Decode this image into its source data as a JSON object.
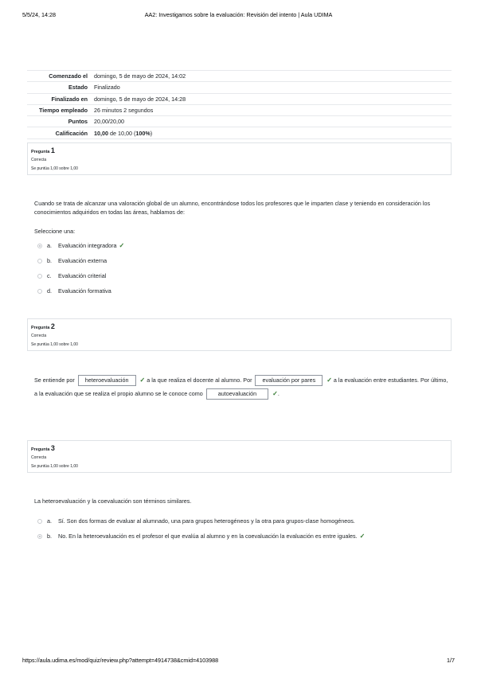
{
  "print": {
    "date": "5/5/24, 14:28",
    "title": "AA2: Investigamos sobre la evaluación: Revisión del intento | Aula UDIMA",
    "url": "https://aula.udima.es/mod/quiz/review.php?attempt=4914738&cmid=4103988",
    "page": "1/7"
  },
  "summary": [
    {
      "label": "Comenzado el",
      "value": "domingo, 5 de mayo de 2024, 14:02"
    },
    {
      "label": "Estado",
      "value": "Finalizado"
    },
    {
      "label": "Finalizado en",
      "value": "domingo, 5 de mayo de 2024, 14:28"
    },
    {
      "label": "Tiempo empleado",
      "value": "26 minutos 2 segundos"
    },
    {
      "label": "Puntos",
      "value": "20,00/20,00"
    },
    {
      "label": "Calificación",
      "grade": "10,00",
      "of": " de 10,00 (",
      "percent": "100%",
      "close": ")"
    }
  ],
  "questions": [
    {
      "prefix": "Pregunta ",
      "number": "1",
      "state": "Correcta",
      "mark": "Se puntúa 1,00 sobre 1,00",
      "text": "Cuando se trata de alcanzar una valoración global de un alumno, encontrándose todos los profesores que le imparten clase y teniendo en consideración los conocimientos adquiridos en todas las áreas, hablamos de:",
      "prompt": "Seleccione una:",
      "options": [
        {
          "letter": "a.",
          "text": "Evaluación integradora",
          "checked": true,
          "correct": true
        },
        {
          "letter": "b.",
          "text": "Evaluación externa",
          "checked": false,
          "correct": false
        },
        {
          "letter": "c.",
          "text": "Evaluación criterial",
          "checked": false,
          "correct": false
        },
        {
          "letter": "d.",
          "text": "Evaluación formativa",
          "checked": false,
          "correct": false
        }
      ]
    },
    {
      "prefix": "Pregunta ",
      "number": "2",
      "state": "Correcta",
      "mark": "Se puntúa 1,00 sobre 1,00",
      "parts": {
        "t1": "Se entiende por",
        "b1": "heteroevaluación",
        "t2": "a la que realiza el docente al alumno. Por",
        "b2": "evaluación por pares",
        "t3": "a la evaluación entre estudiantes. Por último, a la evaluación que se realiza el propio alumno se le conoce como",
        "b3": "autoevaluación",
        "t4": "."
      }
    },
    {
      "prefix": "Pregunta ",
      "number": "3",
      "state": "Correcta",
      "mark": "Se puntúa 1,00 sobre 1,00",
      "text": "La heteroevaluación y la coevaluación son términos similares.",
      "options": [
        {
          "letter": "a.",
          "text": "Sí. Son dos formas de evaluar al alumnado, una para grupos heterogéneos y la otra para grupos-clase homogéneos.",
          "checked": false,
          "correct": false
        },
        {
          "letter": "b.",
          "text": "No. En la heteroevaluación es el profesor el que evalúa al alumno y en la coevaluación la evaluación es entre iguales.",
          "checked": true,
          "correct": true
        }
      ]
    }
  ],
  "icons": {
    "check": "check-icon",
    "radio": "radio-icon"
  },
  "colors": {
    "correct": "#357a32"
  }
}
